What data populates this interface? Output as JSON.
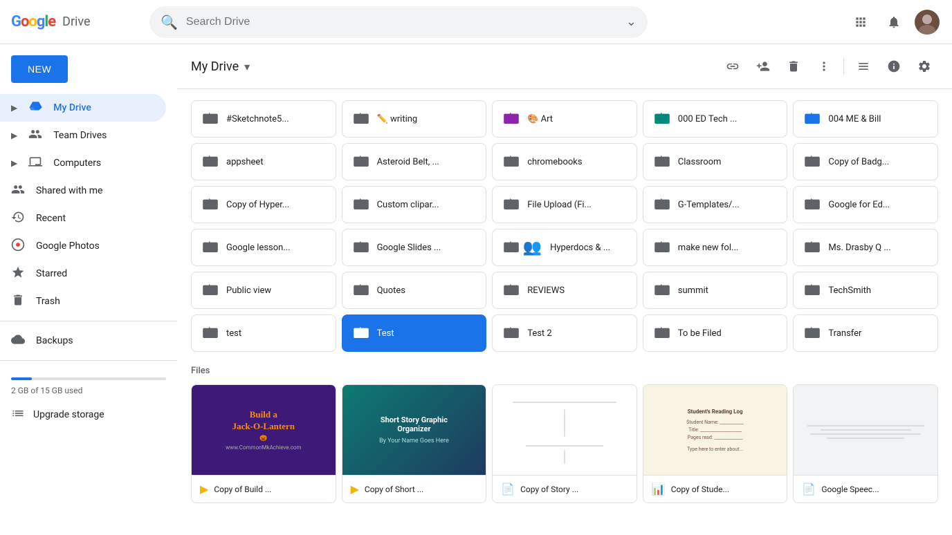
{
  "topbar": {
    "logo": {
      "google": "Google",
      "drive": "Drive"
    },
    "search": {
      "placeholder": "Search Drive",
      "value": ""
    },
    "icons": [
      "grid-apps",
      "bell",
      "question",
      "settings",
      "avatar"
    ]
  },
  "sidebar": {
    "new_button": "NEW",
    "items": [
      {
        "id": "my-drive",
        "label": "My Drive",
        "icon": "drive",
        "active": true
      },
      {
        "id": "team-drives",
        "label": "Team Drives",
        "icon": "team"
      },
      {
        "id": "computers",
        "label": "Computers",
        "icon": "computer"
      },
      {
        "id": "shared-with-me",
        "label": "Shared with me",
        "icon": "people"
      },
      {
        "id": "recent",
        "label": "Recent",
        "icon": "clock"
      },
      {
        "id": "google-photos",
        "label": "Google Photos",
        "icon": "photos"
      },
      {
        "id": "starred",
        "label": "Starred",
        "icon": "star"
      },
      {
        "id": "trash",
        "label": "Trash",
        "icon": "trash"
      },
      {
        "id": "backups",
        "label": "Backups",
        "icon": "cloud"
      }
    ],
    "storage": {
      "label": "2 GB of 15 GB used",
      "used_gb": 2,
      "total_gb": 15,
      "percent": 13.3
    },
    "upgrade_label": "Upgrade storage"
  },
  "breadcrumb": {
    "title": "My Drive",
    "chevron": "▾"
  },
  "toolbar_actions": [
    "link",
    "add-person",
    "delete",
    "more-vert",
    "list-view",
    "info",
    "settings"
  ],
  "folders": [
    {
      "name": "#Sketchnote5...",
      "icon": "folder",
      "color": "gray"
    },
    {
      "name": "✏️ writing",
      "icon": "folder",
      "color": "gray"
    },
    {
      "name": "🎨 Art",
      "icon": "folder",
      "color": "purple"
    },
    {
      "name": "000 ED Tech ...",
      "icon": "folder",
      "color": "teal"
    },
    {
      "name": "004 ME & Bill",
      "icon": "folder",
      "color": "blue"
    },
    {
      "name": "appsheet",
      "icon": "folder",
      "color": "gray"
    },
    {
      "name": "Asteroid Belt, ...",
      "icon": "folder",
      "color": "gray"
    },
    {
      "name": "chromebooks",
      "icon": "folder",
      "color": "gray"
    },
    {
      "name": "Classroom",
      "icon": "folder",
      "color": "gray"
    },
    {
      "name": "Copy of Badg...",
      "icon": "folder",
      "color": "gray"
    },
    {
      "name": "Copy of Hyper...",
      "icon": "folder",
      "color": "gray"
    },
    {
      "name": "Custom clipar...",
      "icon": "folder",
      "color": "gray"
    },
    {
      "name": "File Upload (Fi...",
      "icon": "folder",
      "color": "gray"
    },
    {
      "name": "G-Templates/...",
      "icon": "folder",
      "color": "gray"
    },
    {
      "name": "Google for Ed...",
      "icon": "folder",
      "color": "gray"
    },
    {
      "name": "Google lesson...",
      "icon": "folder",
      "color": "gray"
    },
    {
      "name": "Google Slides ...",
      "icon": "folder",
      "color": "gray"
    },
    {
      "name": "Hyperdocs & ...",
      "icon": "folder-shared",
      "color": "gray"
    },
    {
      "name": "make new fol...",
      "icon": "folder",
      "color": "gray"
    },
    {
      "name": "Ms. Drasby Q ...",
      "icon": "folder-shared",
      "color": "gray"
    },
    {
      "name": "Public view",
      "icon": "folder",
      "color": "gray"
    },
    {
      "name": "Quotes",
      "icon": "folder",
      "color": "gray"
    },
    {
      "name": "REVIEWS",
      "icon": "folder",
      "color": "gray"
    },
    {
      "name": "summit",
      "icon": "folder",
      "color": "gray"
    },
    {
      "name": "TechSmith",
      "icon": "folder",
      "color": "gray"
    },
    {
      "name": "test",
      "icon": "folder",
      "color": "gray"
    },
    {
      "name": "Test",
      "icon": "folder",
      "color": "blue",
      "selected": true
    },
    {
      "name": "Test 2",
      "icon": "folder",
      "color": "gray"
    },
    {
      "name": "To be Filed",
      "icon": "folder",
      "color": "gray"
    },
    {
      "name": "Transfer",
      "icon": "folder",
      "color": "gray"
    }
  ],
  "files_label": "Files",
  "files": [
    {
      "name": "Copy of Build ...",
      "type": "slides",
      "preview": "halloween",
      "color": "#3d1a78"
    },
    {
      "name": "Copy of Short ...",
      "type": "slides",
      "preview": "shortstory",
      "color": "#0d9488"
    },
    {
      "name": "Copy of Story ...",
      "type": "docs",
      "preview": "worksheet",
      "color": "#fff"
    },
    {
      "name": "Copy of Stude...",
      "type": "sheets",
      "preview": "readinglog",
      "color": "#f9f3e3"
    },
    {
      "name": "Google Speec...",
      "type": "docs",
      "preview": "gray",
      "color": "#e8e8e8"
    }
  ],
  "colors": {
    "blue": "#1a73e8",
    "gray": "#5f6368",
    "purple": "#8e24aa",
    "teal": "#009688",
    "light_teal": "#b2dfdb",
    "selected_bg": "#1a73e8",
    "sidebar_active_bg": "#e8f0fe"
  }
}
